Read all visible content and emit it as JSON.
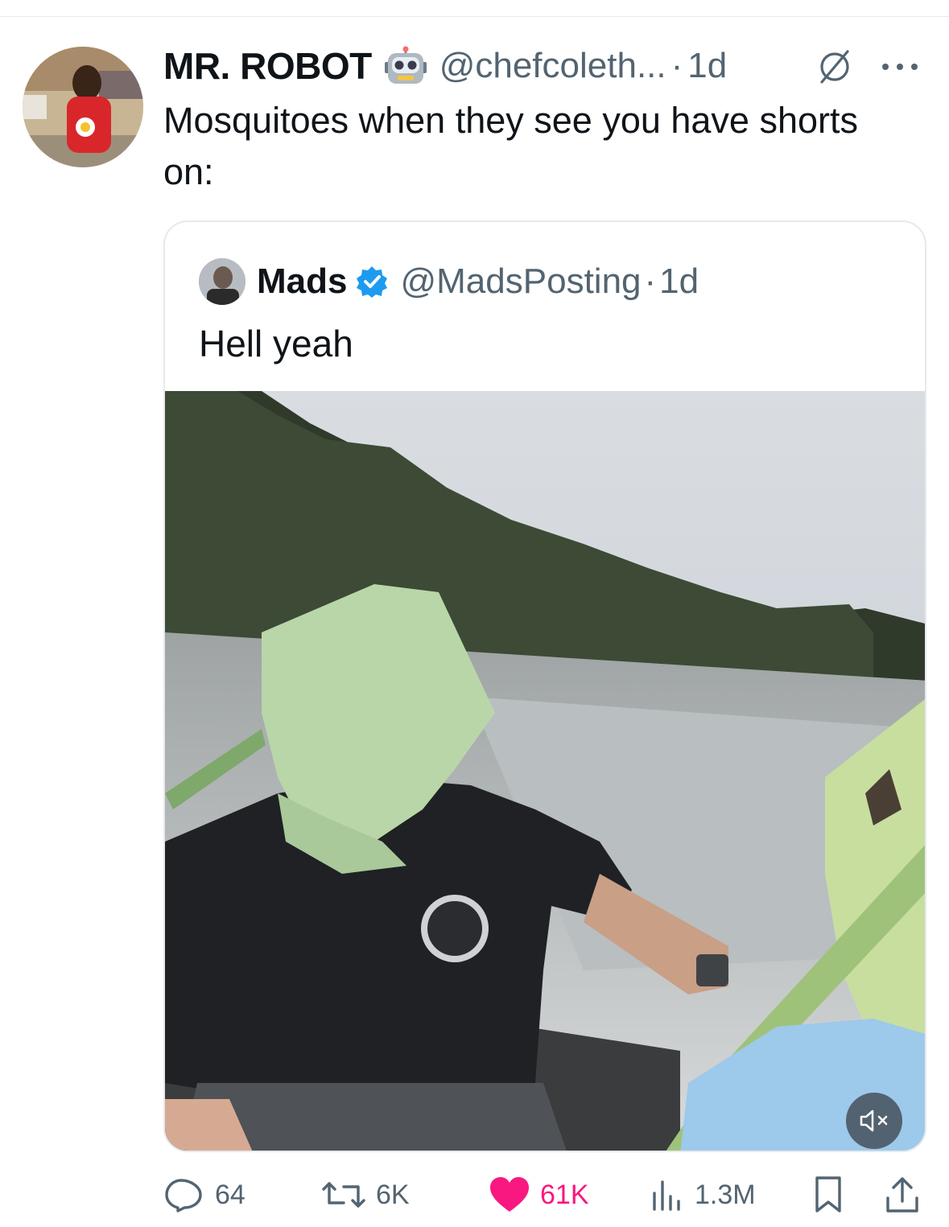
{
  "tweet": {
    "display_name": "MR. ROBOT",
    "badge_emoji": "robot-face-emoji",
    "handle": "@chefcoleth...",
    "separator": "·",
    "time": "1d",
    "text": "Mosquitoes when they see you have shorts on:"
  },
  "quote": {
    "display_name": "Mads",
    "handle": "@MadsPosting",
    "separator": "·",
    "time": "1d",
    "text": "Hell yeah",
    "media": {
      "type": "video",
      "muted": true
    }
  },
  "actions": {
    "replies": "64",
    "reposts": "6K",
    "likes": "61K",
    "views": "1.3M"
  },
  "colors": {
    "text_primary": "#0f1419",
    "text_secondary": "#536471",
    "like_pink": "#f91880",
    "verified_blue": "#1d9bf0",
    "divider": "#e6e9ec"
  },
  "icons": [
    "grok-icon",
    "more-icon",
    "verified-icon",
    "mute-icon",
    "reply-icon",
    "repost-icon",
    "like-icon",
    "views-icon",
    "bookmark-icon",
    "share-icon"
  ]
}
